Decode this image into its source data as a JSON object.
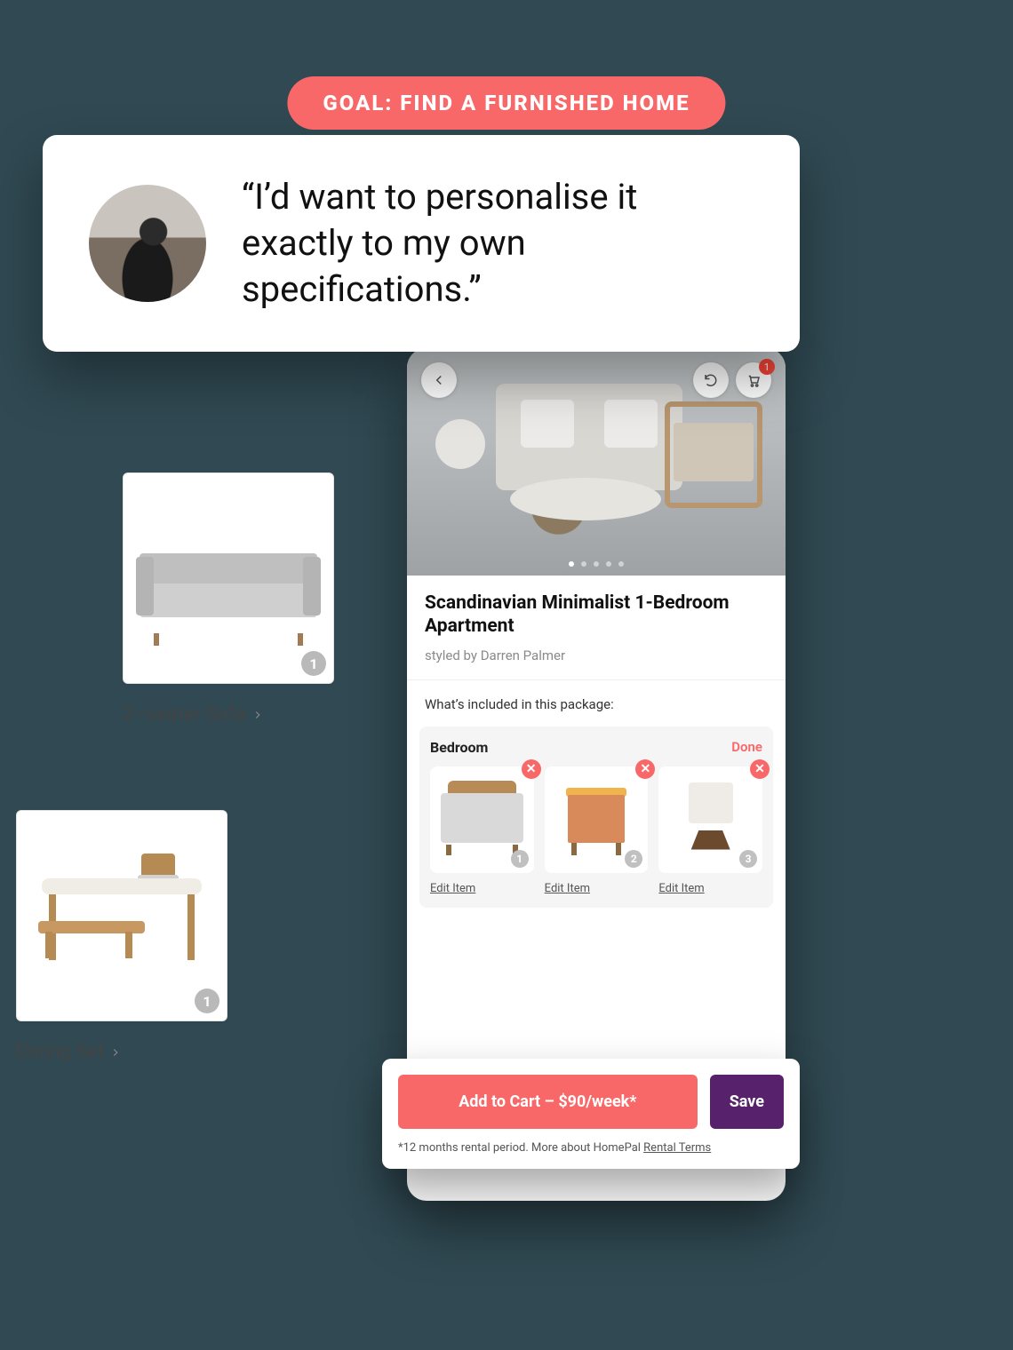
{
  "goal_banner": "GOAL: FIND A FURNISHED HOME",
  "quote": "“I’d want to personalise it exactly to my own specifications.”",
  "tiles": {
    "sofa": {
      "label": "2–seater Sofa",
      "count": "1"
    },
    "dining": {
      "label": "Dining Set",
      "count": "1"
    }
  },
  "app": {
    "cart_count": "1",
    "title": "Scandinavian Minimalist 1-Bedroom Apartment",
    "subtitle": "styled by Darren Palmer",
    "package_heading": "What’s included in this package:",
    "room": {
      "name": "Bedroom",
      "done": "Done",
      "items": [
        {
          "order": "1",
          "edit": "Edit Item"
        },
        {
          "order": "2",
          "edit": "Edit Item"
        },
        {
          "order": "3",
          "edit": "Edit Item"
        }
      ]
    }
  },
  "footer": {
    "add_to_cart": "Add to Cart  –  $90/week*",
    "save": "Save",
    "terms_prefix": "*12 months rental period. More about HomePal ",
    "terms_link": "Rental Terms"
  }
}
